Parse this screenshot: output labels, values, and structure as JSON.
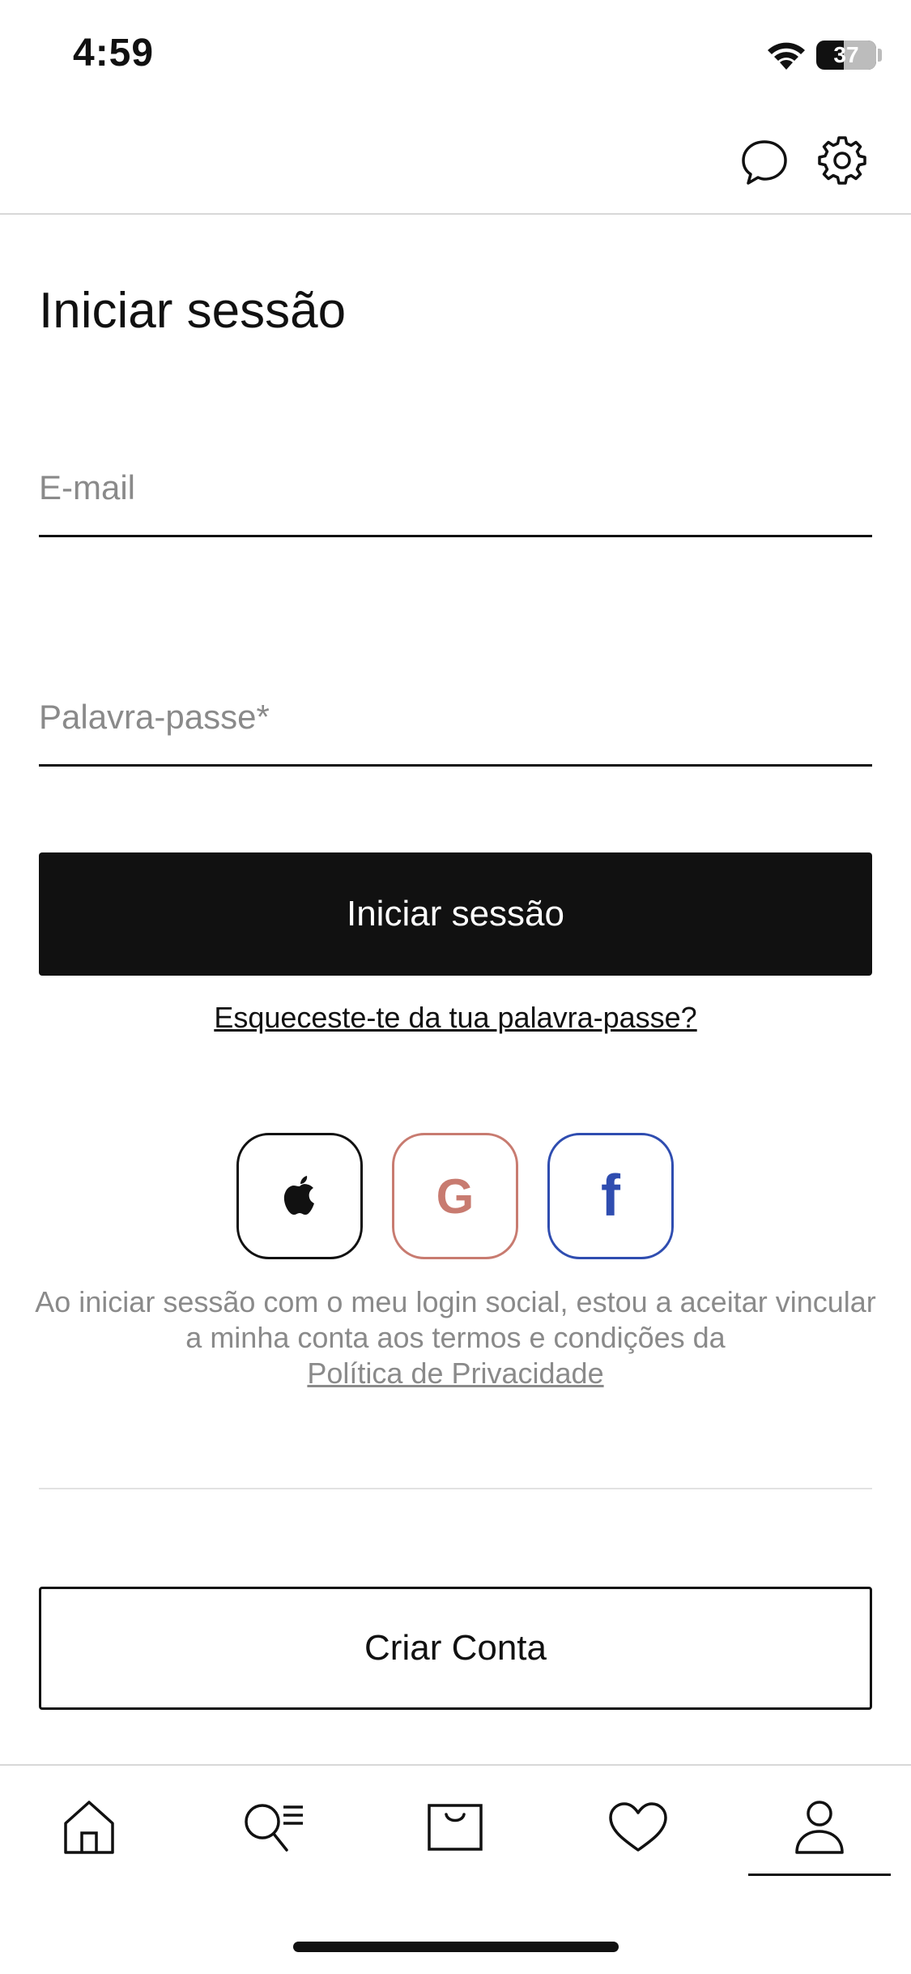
{
  "status_bar": {
    "time": "4:59",
    "battery": "37"
  },
  "header": {
    "chat_icon": "chat-bubble-icon",
    "settings_icon": "gear-icon"
  },
  "login": {
    "title": "Iniciar sessão",
    "email_placeholder": "E-mail",
    "password_placeholder": "Palavra-passe*",
    "submit_label": "Iniciar sessão",
    "forgot_password": "Esqueceste-te da tua palavra-passe?"
  },
  "social": {
    "providers": [
      "apple",
      "google",
      "facebook"
    ],
    "google_letter": "G",
    "facebook_letter": "f",
    "legal_text": "Ao iniciar sessão com o meu login social, estou a aceitar vincular a minha conta aos termos e condições da",
    "privacy_link": "Política de Privacidade"
  },
  "register": {
    "label": "Criar Conta"
  },
  "tab_bar": {
    "items": [
      "home-icon",
      "search-icon",
      "bag-icon",
      "heart-icon",
      "account-icon"
    ],
    "active": "account-icon"
  },
  "colors": {
    "primary": "#111111",
    "placeholder": "#8a8a8a",
    "google": "#c87b70",
    "facebook": "#2f4db0",
    "divider": "#d8d8d8"
  }
}
